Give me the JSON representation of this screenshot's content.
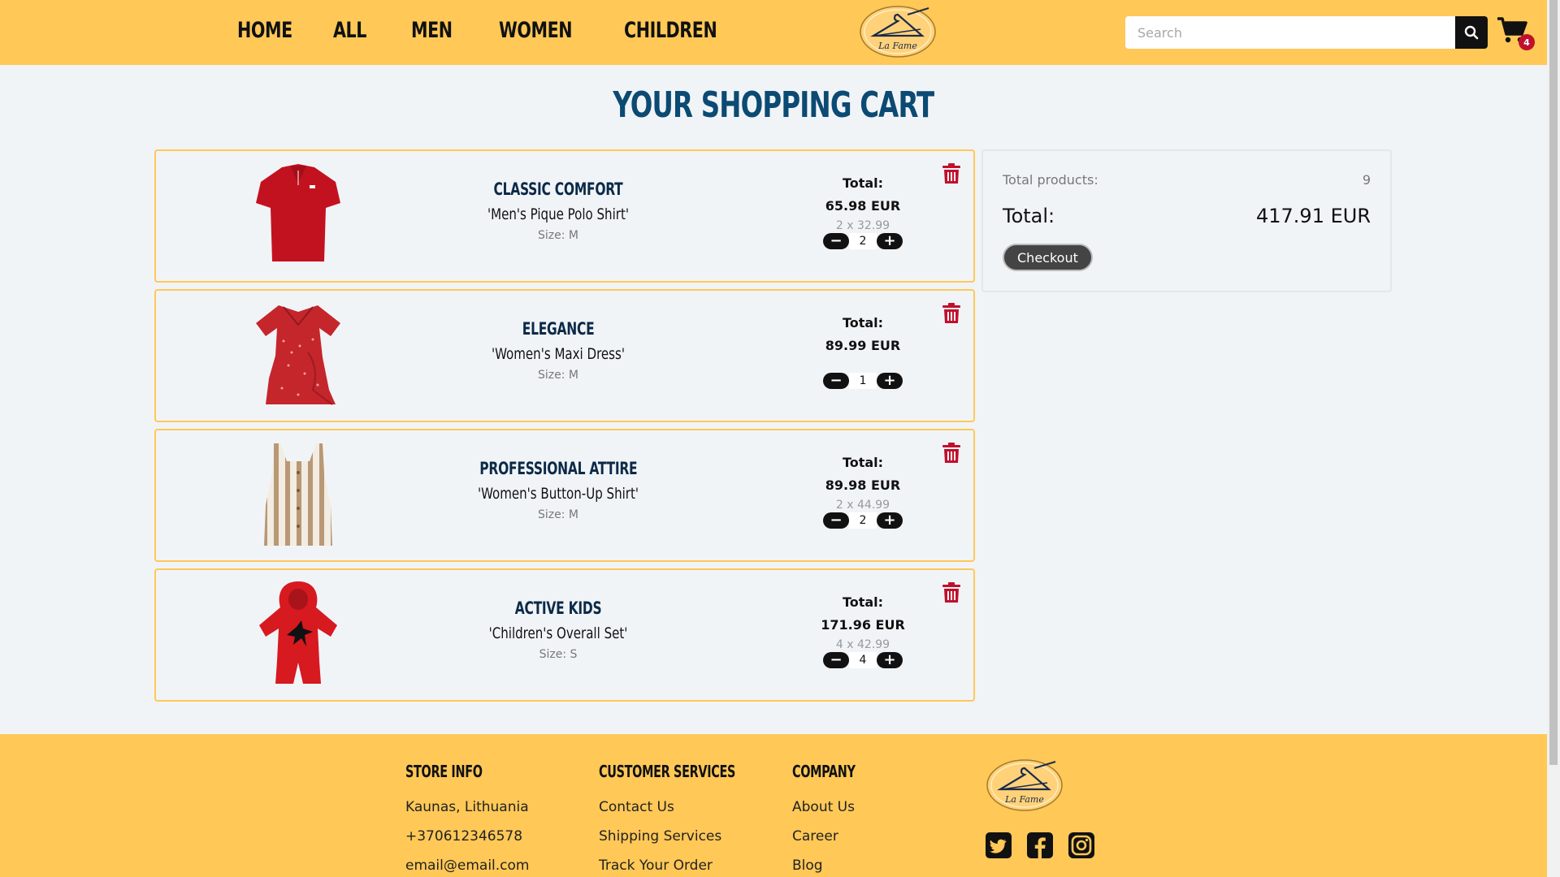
{
  "nav": {
    "items": [
      "HOME",
      "ALL",
      "MEN",
      "WOMEN",
      "CHILDREN"
    ]
  },
  "logo": {
    "text": "La Fame"
  },
  "search": {
    "placeholder": "Search",
    "value": ""
  },
  "cart": {
    "count": "4"
  },
  "page": {
    "title": "YOUR SHOPPING CART"
  },
  "items": [
    {
      "brand": "Classic Comfort",
      "name": "'Men's Pique Polo Shirt'",
      "size": "Size: M",
      "total_label": "Total:",
      "total": "65.98 EUR",
      "unit": "2 x 32.99",
      "qty": "2",
      "image": "red-polo-shirt",
      "color": "#c3121f"
    },
    {
      "brand": "Elegance",
      "name": "'Women's Maxi Dress'",
      "size": "Size: M",
      "total_label": "Total:",
      "total": "89.99 EUR",
      "unit": "",
      "qty": "1",
      "image": "red-floral-dress",
      "color": "#c4262c"
    },
    {
      "brand": "Professional Attire",
      "name": "'Women's Button-Up Shirt'",
      "size": "Size: M",
      "total_label": "Total:",
      "total": "89.98 EUR",
      "unit": "2 x 44.99",
      "qty": "2",
      "image": "striped-button-dress",
      "color": "#b99875"
    },
    {
      "brand": "Active Kids",
      "name": "'Children's Overall Set'",
      "size": "Size: S",
      "total_label": "Total:",
      "total": "171.96 EUR",
      "unit": "4 x 42.99",
      "qty": "4",
      "image": "red-hooded-romper",
      "color": "#d71920"
    }
  ],
  "summary": {
    "products_label": "Total products:",
    "products_count": "9",
    "total_label": "Total:",
    "total_value": "417.91 EUR",
    "checkout_label": "Checkout"
  },
  "footer": {
    "store_info": {
      "title": "Store Info",
      "lines": [
        "Kaunas, Lithuania",
        "+370612346578",
        "email@email.com"
      ]
    },
    "customer_services": {
      "title": "Customer Services",
      "lines": [
        "Contact Us",
        "Shipping Services",
        "Track Your Order"
      ]
    },
    "company": {
      "title": "Company",
      "lines": [
        "About Us",
        "Career",
        "Blog"
      ]
    },
    "socials": [
      "twitter-icon",
      "facebook-icon",
      "instagram-icon"
    ]
  },
  "colors": {
    "accent": "#ffc857",
    "title": "#0b4a73",
    "danger": "#c0102c"
  }
}
